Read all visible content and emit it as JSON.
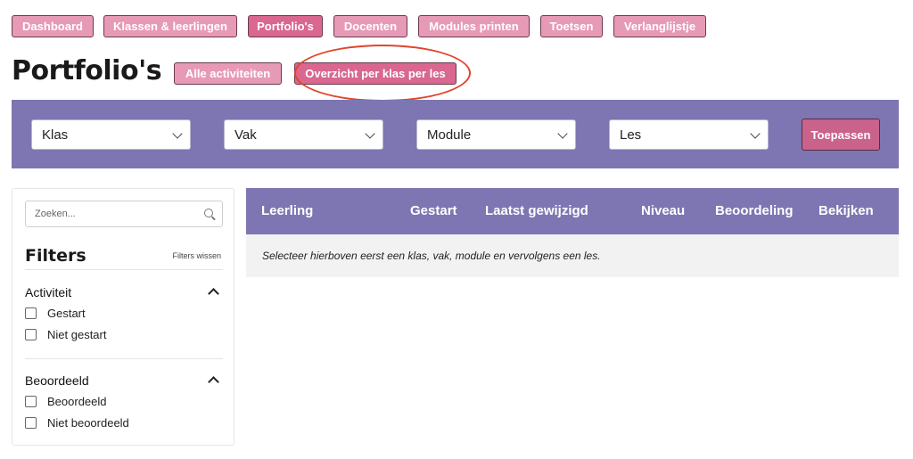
{
  "nav": {
    "items": [
      "Dashboard",
      "Klassen & leerlingen",
      "Portfolio's",
      "Docenten",
      "Modules printen",
      "Toetsen",
      "Verlanglijstje"
    ],
    "active_index": 2
  },
  "page": {
    "title": "Portfolio's",
    "subnav": [
      "Alle activiteiten",
      "Overzicht per klas per les"
    ],
    "subnav_active_index": 1
  },
  "filterbar": {
    "selects": [
      "Klas",
      "Vak",
      "Module",
      "Les"
    ],
    "apply_label": "Toepassen"
  },
  "sidebar": {
    "search_placeholder": "Zoeken...",
    "filters_title": "Filters",
    "clear_label": "Filters wissen",
    "groups": [
      {
        "title": "Activiteit",
        "options": [
          "Gestart",
          "Niet gestart"
        ]
      },
      {
        "title": "Beoordeeld",
        "options": [
          "Beoordeeld",
          "Niet beoordeeld"
        ]
      }
    ]
  },
  "table": {
    "columns": [
      "Leerling",
      "Gestart",
      "Laatst gewijzigd",
      "Niveau",
      "Beoordeling",
      "Bekijken"
    ],
    "empty_message": "Selecteer hierboven eerst een klas, vak, module en vervolgens een les."
  },
  "colors": {
    "accent_pink": "#e79ab5",
    "active_pink": "#d9678f",
    "purple": "#7d76b2",
    "highlight_ring": "#e0452c"
  }
}
